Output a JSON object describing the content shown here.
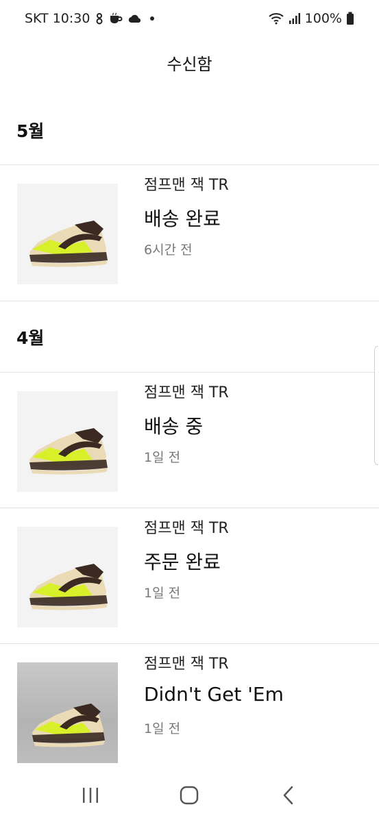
{
  "status_bar": {
    "carrier_time": "SKT 10:30",
    "battery": "100%",
    "icons_left": [
      "notification-icon",
      "cup-icon",
      "cloud-icon",
      "dot-icon"
    ],
    "icons_right": [
      "wifi-icon",
      "signal-icon",
      "battery-icon"
    ]
  },
  "header": {
    "title": "수신함"
  },
  "sections": [
    {
      "label": "5월"
    },
    {
      "label": "4월"
    }
  ],
  "items": [
    {
      "product": "점프맨 잭 TR",
      "status": "배송 완료",
      "time": "6시간 전"
    },
    {
      "product": "점프맨 잭 TR",
      "status": "배송 중",
      "time": "1일 전"
    },
    {
      "product": "점프맨 잭 TR",
      "status": "주문 완료",
      "time": "1일 전"
    },
    {
      "product": "점프맨 잭 TR",
      "status": "Didn't Get 'Em",
      "time": "1일 전"
    }
  ],
  "colors": {
    "sneaker_volt": "#d8f02a",
    "sneaker_beige": "#eadbb6",
    "sneaker_brown": "#3a2a22",
    "divider": "#e3e3e3",
    "muted_text": "#777777"
  },
  "nav": {
    "buttons": [
      "recent-apps-icon",
      "home-icon",
      "back-icon"
    ]
  }
}
